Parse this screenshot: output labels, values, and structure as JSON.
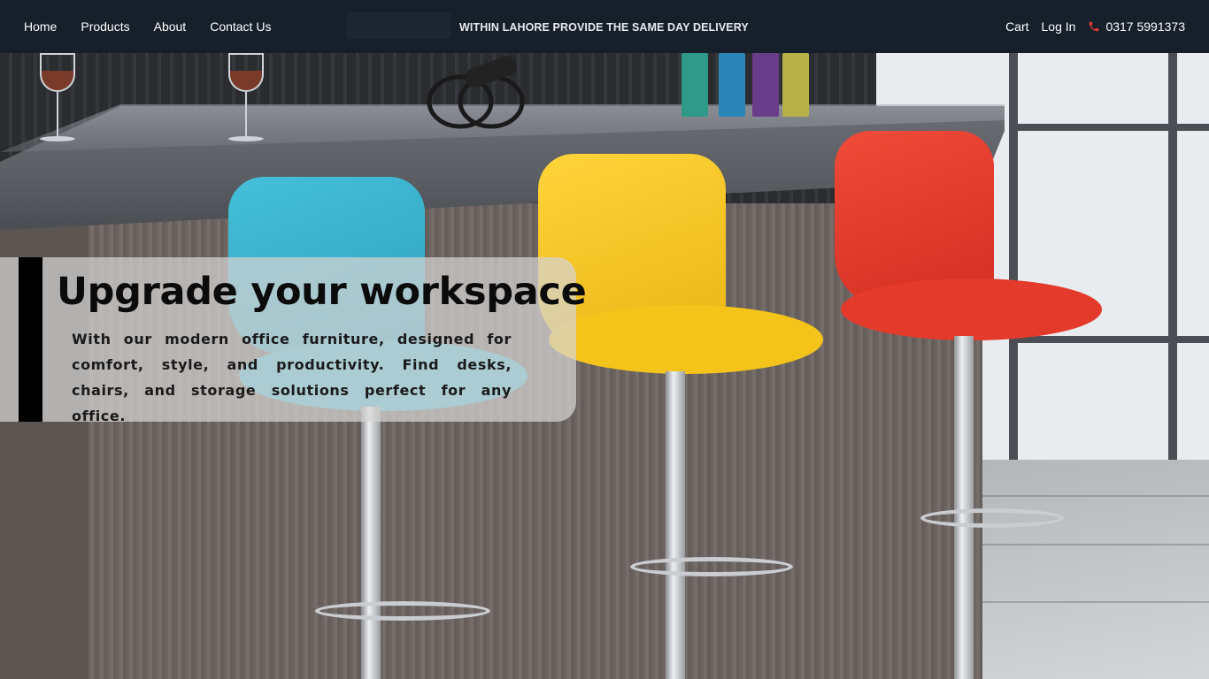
{
  "nav": {
    "links": [
      "Home",
      "Products",
      "About",
      "Contact Us"
    ],
    "promo": "WITHIN LAHORE PROVIDE THE SAME DAY DELIVERY",
    "cart": "Cart",
    "login": "Log In",
    "phone": "0317 5991373"
  },
  "hero": {
    "headline": "Upgrade your workspace",
    "subtext": "With our modern office furniture, designed for comfort, style, and productivity. Find desks, chairs, and storage solutions perfect for any office.",
    "image_icon": "bar-stools-photo"
  },
  "colors": {
    "navbar": "#15202b",
    "accent_bar": "#000000",
    "stool_blue": "#3fb6cf",
    "stool_yellow": "#f4c41a",
    "stool_red": "#e43a2c",
    "phone_icon": "#e53935"
  }
}
